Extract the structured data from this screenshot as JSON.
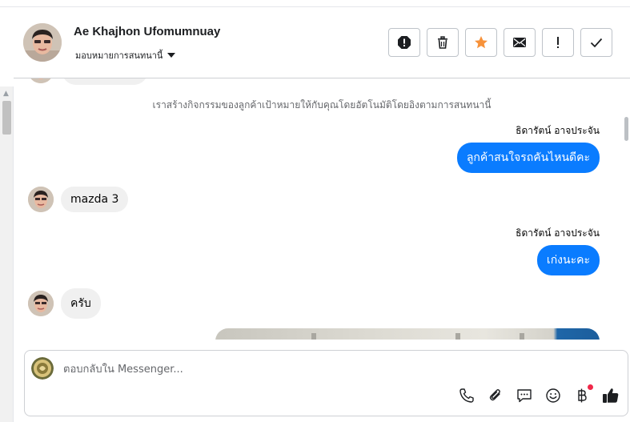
{
  "header": {
    "contact_name": "Ae Khajhon Ufomumnuay",
    "assign_label": "มอบหมายการสนทนานี้",
    "actions": [
      {
        "name": "spam-icon",
        "label": "Mark as spam"
      },
      {
        "name": "trash-icon",
        "label": "Delete"
      },
      {
        "name": "star-icon",
        "label": "Follow up"
      },
      {
        "name": "envelope-icon",
        "label": "Mark as unread"
      },
      {
        "name": "exclamation-icon",
        "label": "Mark as important"
      },
      {
        "name": "check-icon",
        "label": "Done"
      }
    ]
  },
  "conversation": {
    "system_note": "เราสร้างกิจกรรมของลูกค้าเป้าหมายให้กับคุณโดยอัตโนมัติโดยอิงตามการสนทนานี้",
    "messages": [
      {
        "direction": "out",
        "sender": "ธิดารัตน์ อาจประจัน",
        "text": "ลูกค้าสนใจรถคันไหนดีคะ"
      },
      {
        "direction": "in",
        "text": "mazda 3"
      },
      {
        "direction": "out",
        "sender": "ธิดารัตน์ อาจประจัน",
        "text": "เก่งนะคะ"
      },
      {
        "direction": "in",
        "text": "ครับ"
      }
    ]
  },
  "composer": {
    "placeholder": "ตอบกลับใน Messenger...",
    "tools": [
      "phone-icon",
      "paperclip-icon",
      "saved-replies-icon",
      "emoji-icon",
      "baht-icon",
      "like-icon"
    ]
  },
  "colors": {
    "outgoing_bubble": "#0a7cff",
    "incoming_bubble": "#f0f0f0",
    "star": "#f7923a",
    "notification_dot": "#f02849"
  }
}
